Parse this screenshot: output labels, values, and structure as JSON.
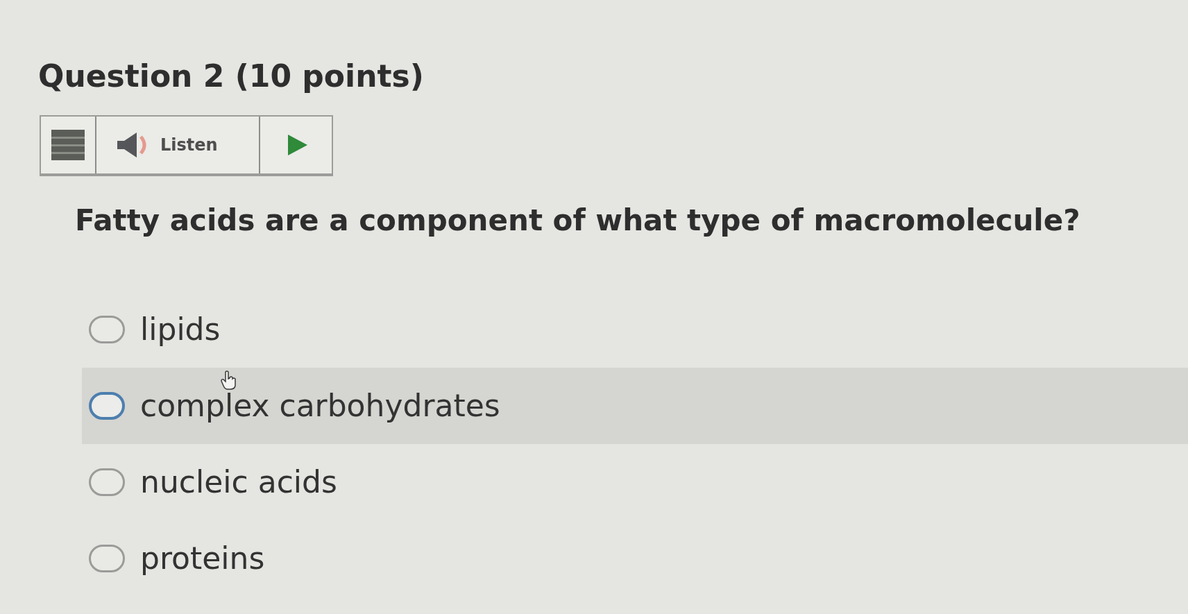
{
  "question": {
    "title": "Question 2 (10 points)"
  },
  "toolbar": {
    "listen_label": "Listen"
  },
  "prompt": "Fatty acids are a component of what type of macromolecule?",
  "options": [
    {
      "label": "lipids",
      "selected": false,
      "hovered": false
    },
    {
      "label": "complex carbohydrates",
      "selected": false,
      "hovered": true
    },
    {
      "label": "nucleic acids",
      "selected": false,
      "hovered": false
    },
    {
      "label": "proteins",
      "selected": false,
      "hovered": false
    }
  ]
}
